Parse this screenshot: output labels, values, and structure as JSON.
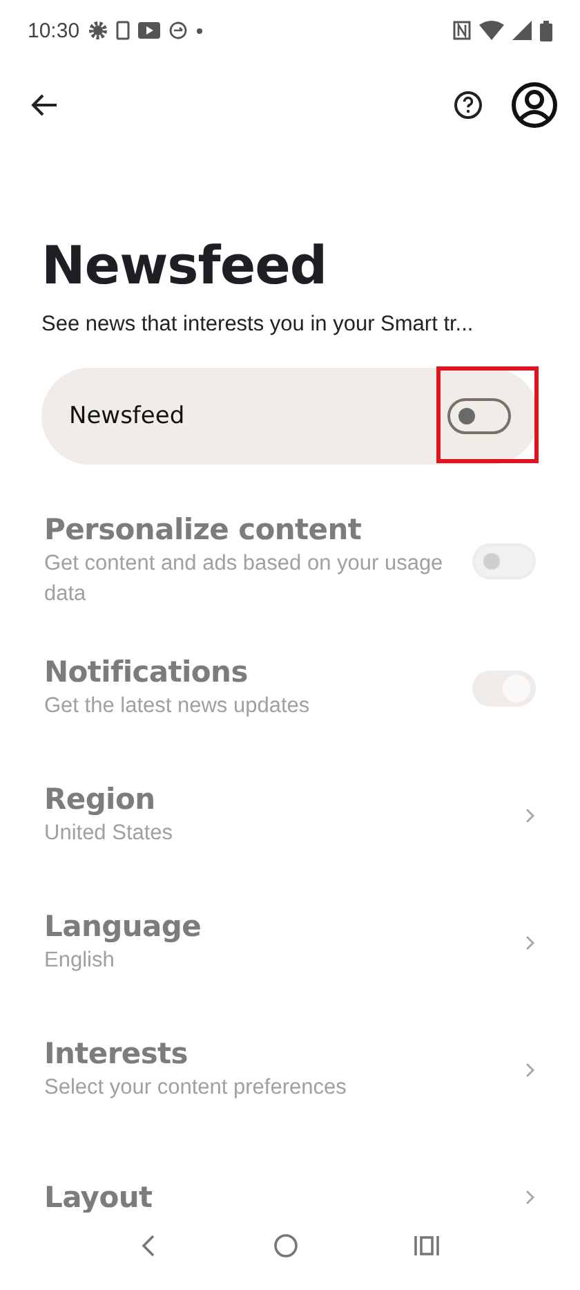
{
  "status_bar": {
    "time": "10:30"
  },
  "header": {
    "title": "Newsfeed",
    "subtitle": "See news that interests you in your Smart tr..."
  },
  "master_toggle": {
    "label": "Newsfeed",
    "on": false,
    "highlighted": true
  },
  "settings": [
    {
      "kind": "toggle",
      "title": "Personalize content",
      "subtitle": "Get content and ads based on your usage data",
      "on": false,
      "disabled": true
    },
    {
      "kind": "toggle",
      "title": "Notifications",
      "subtitle": "Get the latest news updates",
      "on": true,
      "disabled": true
    },
    {
      "kind": "link",
      "title": "Region",
      "subtitle": "United States",
      "disabled": true
    },
    {
      "kind": "link",
      "title": "Language",
      "subtitle": "English",
      "disabled": true
    },
    {
      "kind": "link",
      "title": "Interests",
      "subtitle": "Select your content preferences",
      "disabled": true
    },
    {
      "kind": "link",
      "title": "Layout",
      "disabled": true
    }
  ]
}
